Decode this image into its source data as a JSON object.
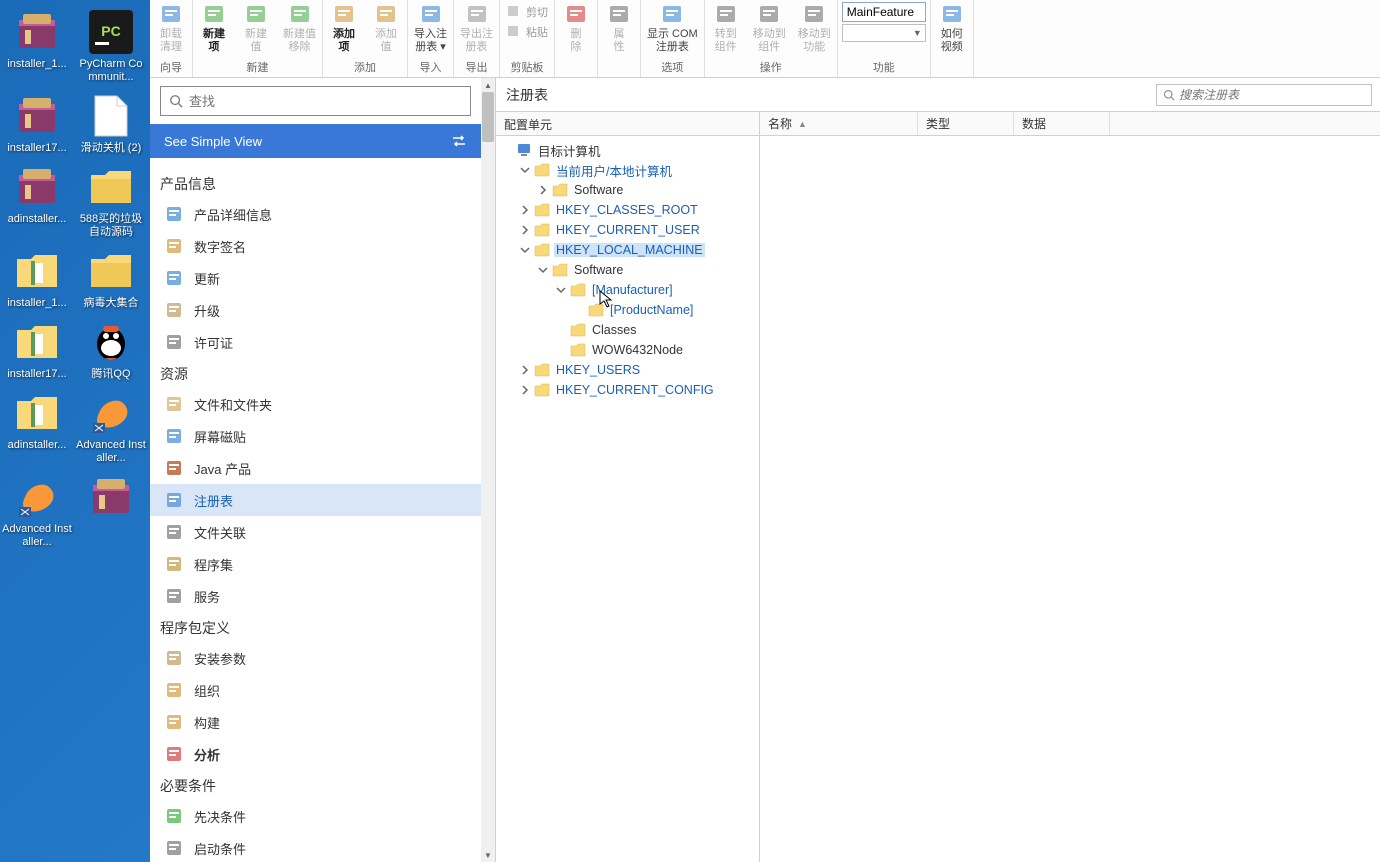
{
  "desktop": [
    {
      "label": "installer_1...",
      "icon": "winrar"
    },
    {
      "label": "PyCharm Communit...",
      "icon": "pycharm"
    },
    {
      "label": "installer17...",
      "icon": "winrar"
    },
    {
      "label": "滑动关机 (2)",
      "icon": "file"
    },
    {
      "label": "adinstaller...",
      "icon": "winrar"
    },
    {
      "label": "588买的垃圾自动源码",
      "icon": "folder"
    },
    {
      "label": "installer_1...",
      "icon": "folder-ai"
    },
    {
      "label": "病毒大集合",
      "icon": "folder"
    },
    {
      "label": "installer17...",
      "icon": "folder-ai"
    },
    {
      "label": "腾讯QQ",
      "icon": "qq"
    },
    {
      "label": "adinstaller...",
      "icon": "folder-ai"
    },
    {
      "label": "Advanced Installer...",
      "icon": "ai-app"
    },
    {
      "label": "Advanced Installer...",
      "icon": "ai-app"
    },
    {
      "label": "",
      "icon": "winrar-partial"
    }
  ],
  "ribbon": {
    "groups": [
      {
        "label": "向导",
        "buttons": [
          {
            "label": "卸载\n清理",
            "disabled": true
          }
        ]
      },
      {
        "label": "新建",
        "buttons": [
          {
            "label": "新建\n项",
            "bold": true
          },
          {
            "label": "新建\n值",
            "disabled": true
          },
          {
            "label": "新建值\n移除",
            "disabled": true
          }
        ]
      },
      {
        "label": "添加",
        "buttons": [
          {
            "label": "添加\n项",
            "bold": true
          },
          {
            "label": "添加\n值",
            "disabled": true
          }
        ]
      },
      {
        "label": "导入",
        "buttons": [
          {
            "label": "导入注\n册表 ▾"
          }
        ]
      },
      {
        "label": "导出",
        "buttons": [
          {
            "label": "导出注\n册表",
            "disabled": true
          }
        ]
      },
      {
        "label": "剪贴板",
        "small": [
          {
            "label": "剪切"
          },
          {
            "label": "粘贴"
          }
        ]
      },
      {
        "label": "",
        "buttons": [
          {
            "label": "删\n除",
            "disabled": true
          }
        ]
      },
      {
        "label": "",
        "buttons": [
          {
            "label": "属\n性",
            "disabled": true
          }
        ]
      },
      {
        "label": "选项",
        "buttons": [
          {
            "label": "显示 COM\n注册表"
          }
        ]
      },
      {
        "label": "操作",
        "buttons": [
          {
            "label": "转到\n组件",
            "disabled": true
          },
          {
            "label": "移动到\n组件",
            "disabled": true
          },
          {
            "label": "移动到\n功能",
            "disabled": true
          }
        ]
      },
      {
        "label": "功能",
        "feature": "MainFeature"
      },
      {
        "label": "",
        "buttons": [
          {
            "label": "如何\n视频"
          }
        ]
      }
    ]
  },
  "sidebar": {
    "search_placeholder": "查找",
    "simple_view": "See Simple View",
    "sections": [
      {
        "title": "产品信息",
        "items": [
          {
            "label": "产品详细信息",
            "icon": "info"
          },
          {
            "label": "数字签名",
            "icon": "sign"
          },
          {
            "label": "更新",
            "icon": "update"
          },
          {
            "label": "升级",
            "icon": "upgrade"
          },
          {
            "label": "许可证",
            "icon": "license"
          }
        ]
      },
      {
        "title": "资源",
        "items": [
          {
            "label": "文件和文件夹",
            "icon": "files"
          },
          {
            "label": "屏幕磁贴",
            "icon": "tiles"
          },
          {
            "label": "Java 产品",
            "icon": "java"
          },
          {
            "label": "注册表",
            "icon": "registry",
            "active": true
          },
          {
            "label": "文件关联",
            "icon": "assoc"
          },
          {
            "label": "程序集",
            "icon": "assembly"
          },
          {
            "label": "服务",
            "icon": "services"
          }
        ]
      },
      {
        "title": "程序包定义",
        "items": [
          {
            "label": "安装参数",
            "icon": "params"
          },
          {
            "label": "组织",
            "icon": "org"
          },
          {
            "label": "构建",
            "icon": "build"
          },
          {
            "label": "分析",
            "icon": "analyze",
            "bold": true
          }
        ]
      },
      {
        "title": "必要条件",
        "items": [
          {
            "label": "先决条件",
            "icon": "prereq"
          },
          {
            "label": "启动条件",
            "icon": "launch"
          }
        ]
      }
    ]
  },
  "right": {
    "title": "注册表",
    "search_placeholder": "搜索注册表",
    "tree_header": "配置单元",
    "list_headers": [
      "名称",
      "类型",
      "数据"
    ],
    "tree": [
      {
        "label": "目标计算机",
        "indent": 0,
        "icon": "pc",
        "color": "black"
      },
      {
        "label": "当前用户/本地计算机",
        "indent": 1,
        "twisty": "open"
      },
      {
        "label": "Software",
        "indent": 2,
        "twisty": "closed",
        "color": "black"
      },
      {
        "label": "HKEY_CLASSES_ROOT",
        "indent": 1,
        "twisty": "closed"
      },
      {
        "label": "HKEY_CURRENT_USER",
        "indent": 1,
        "twisty": "closed"
      },
      {
        "label": "HKEY_LOCAL_MACHINE",
        "indent": 1,
        "twisty": "open",
        "selected": true
      },
      {
        "label": "Software",
        "indent": 2,
        "twisty": "open",
        "color": "black"
      },
      {
        "label": "[Manufacturer]",
        "indent": 3,
        "twisty": "open"
      },
      {
        "label": "[ProductName]",
        "indent": 4
      },
      {
        "label": "Classes",
        "indent": 3,
        "color": "black"
      },
      {
        "label": "WOW6432Node",
        "indent": 3,
        "color": "black"
      },
      {
        "label": "HKEY_USERS",
        "indent": 1,
        "twisty": "closed"
      },
      {
        "label": "HKEY_CURRENT_CONFIG",
        "indent": 1,
        "twisty": "closed"
      }
    ]
  }
}
